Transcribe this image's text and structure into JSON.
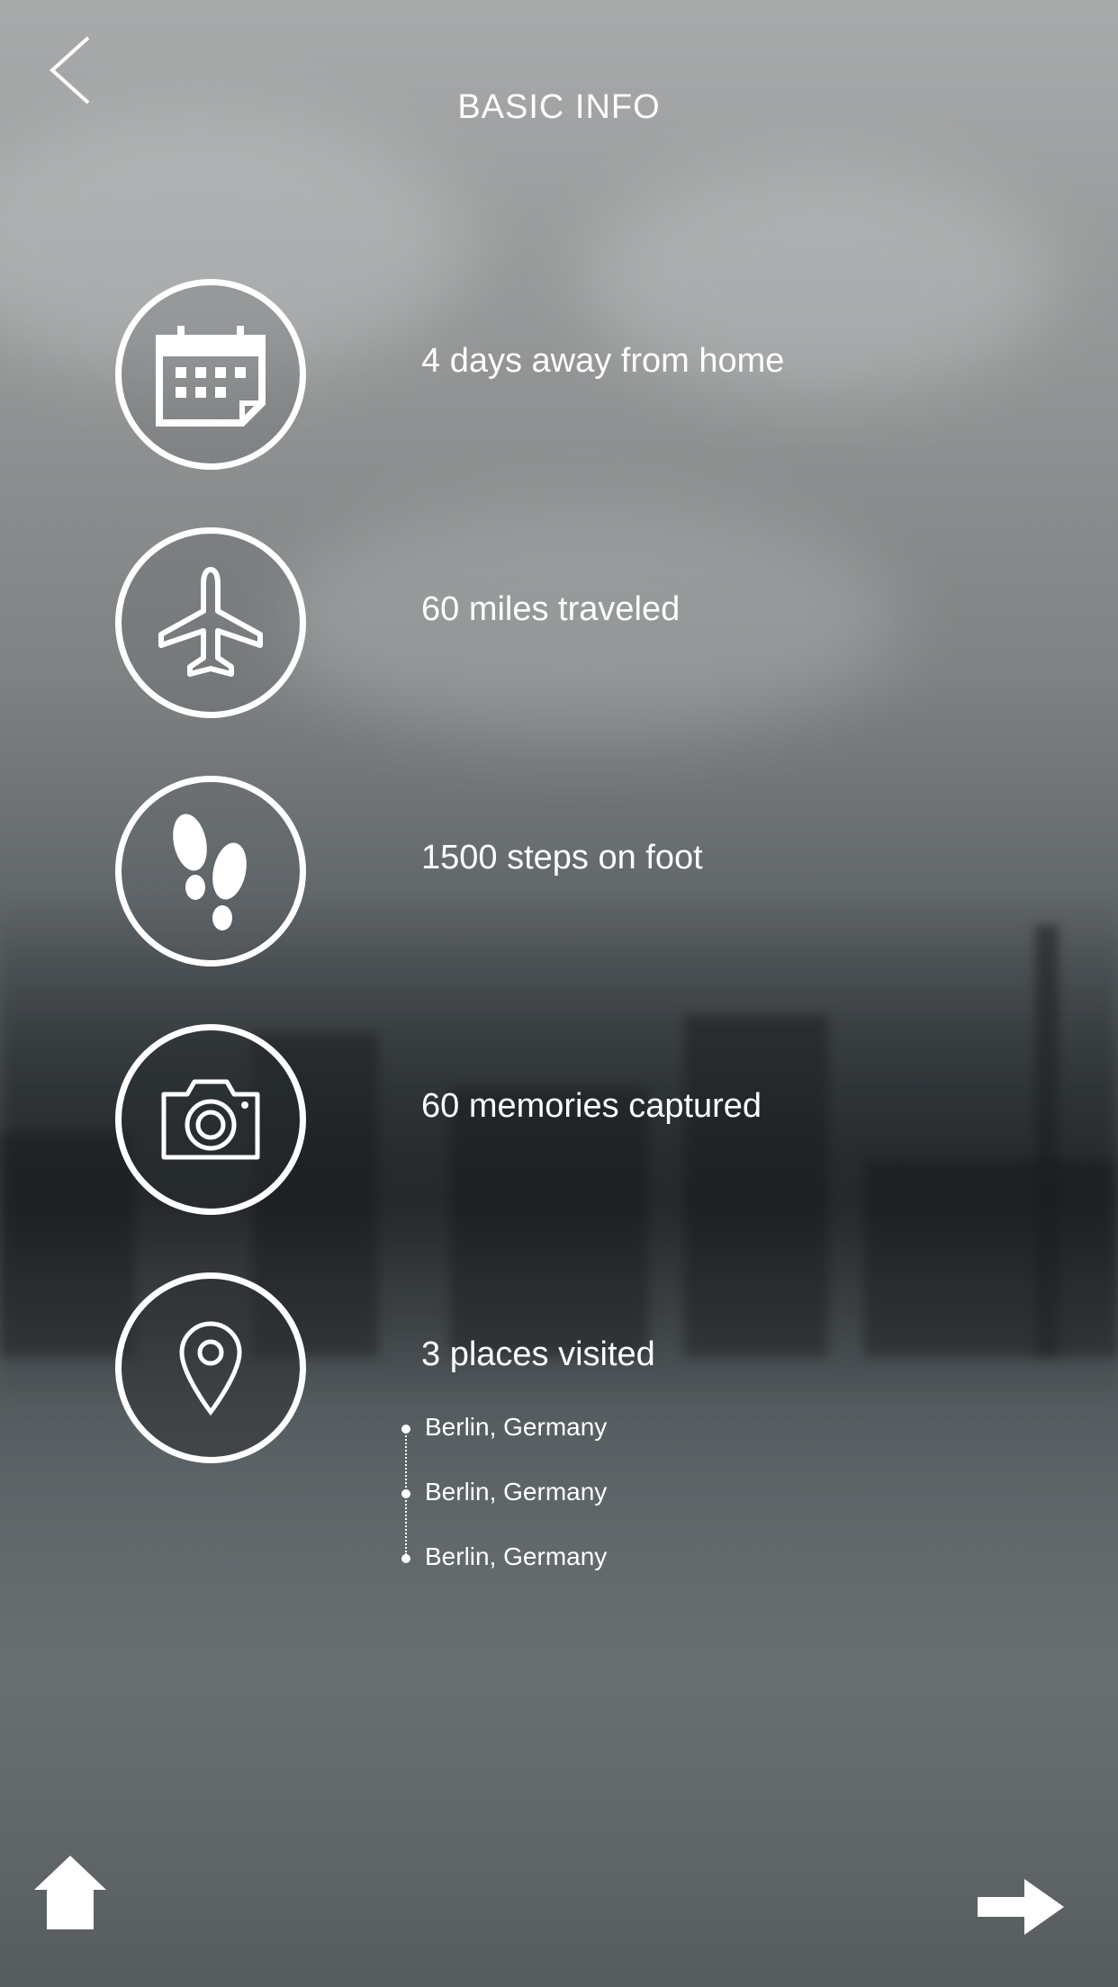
{
  "header": {
    "title": "BASIC INFO",
    "back_icon": "chevron-left-icon"
  },
  "stats": [
    {
      "icon": "calendar-icon",
      "text": "4 days away from home"
    },
    {
      "icon": "airplane-icon",
      "text": "60 miles traveled"
    },
    {
      "icon": "footprints-icon",
      "text": "1500 steps on foot"
    },
    {
      "icon": "camera-icon",
      "text": "60 memories captured"
    },
    {
      "icon": "map-pin-icon",
      "text": "3 places visited"
    }
  ],
  "places": [
    "Berlin, Germany",
    "Berlin, Germany",
    "Berlin, Germany"
  ],
  "footer": {
    "home_icon": "home-icon",
    "next_icon": "arrow-right-icon"
  }
}
